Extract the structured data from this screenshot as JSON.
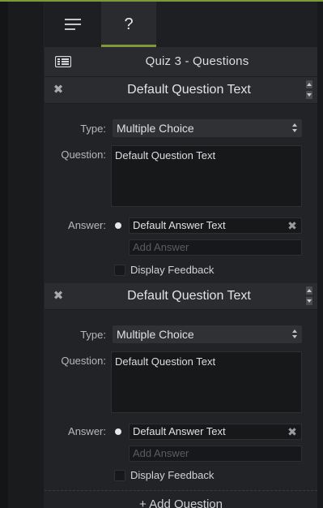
{
  "tabs": {
    "properties": {
      "icon": "hamburger-icon"
    },
    "help": {
      "label": "?"
    }
  },
  "quiz": {
    "icon": "quiz-list-icon",
    "title": "Quiz 3 - Questions"
  },
  "questions": [
    {
      "title": "Default Question Text",
      "type_label": "Type:",
      "type_value": "Multiple Choice",
      "question_label": "Question:",
      "question_value": "Default Question Text",
      "answer_label": "Answer:",
      "answer_value": "Default Answer Text",
      "add_answer_placeholder": "Add Answer",
      "feedback_label": "Display Feedback"
    },
    {
      "title": "Default Question Text",
      "type_label": "Type:",
      "type_value": "Multiple Choice",
      "question_label": "Question:",
      "question_value": "Default Question Text",
      "answer_label": "Answer:",
      "answer_value": "Default Answer Text",
      "add_answer_placeholder": "Add Answer",
      "feedback_label": "Display Feedback"
    }
  ],
  "add_question_label": "+ Add Question",
  "colors": {
    "accent": "#7d9a3a",
    "panel_bg": "#222326",
    "header_bg": "#2b2c2f",
    "field_bg": "#17181a"
  }
}
